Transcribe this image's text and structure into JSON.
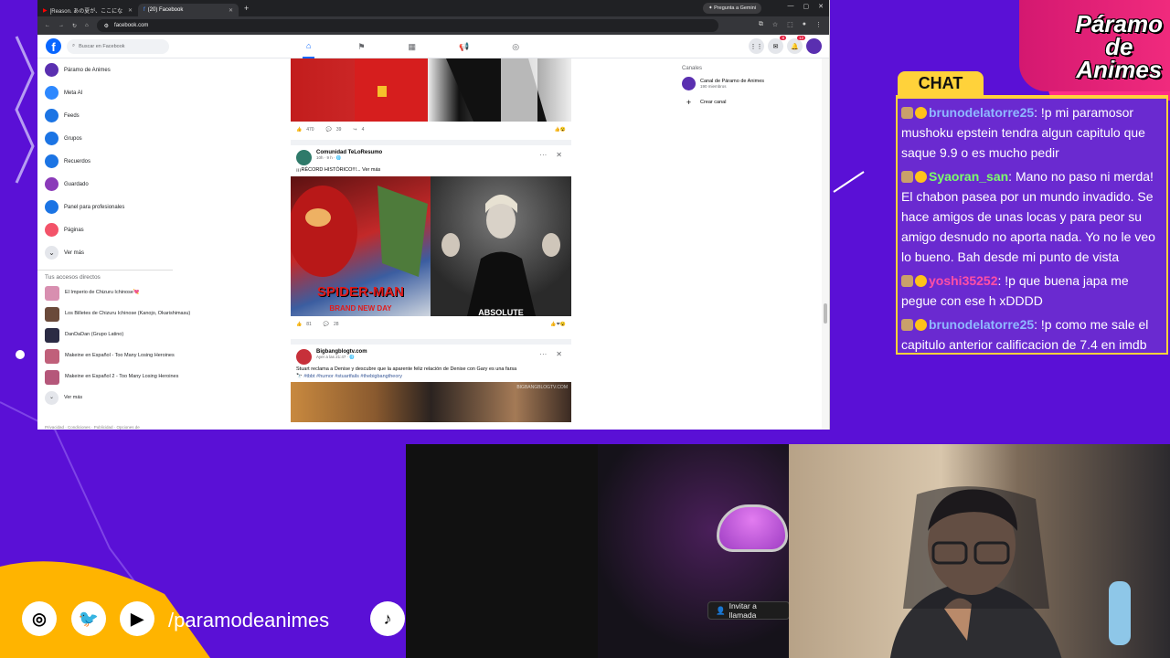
{
  "browser": {
    "tabs": [
      {
        "label": "[Reason. あの夏が、ここにな",
        "active": false
      },
      {
        "label": "(20) Facebook",
        "active": true
      }
    ],
    "gemini_label": "Pregunta a Gemini",
    "url": "facebook.com"
  },
  "fb": {
    "search_placeholder": "Buscar en Facebook",
    "badges": {
      "messenger": "8",
      "notifications": "12"
    },
    "sidebar": [
      {
        "label": "Páramo de Animes",
        "icon": "avatar",
        "color": "#5a2fb0"
      },
      {
        "label": "Meta AI",
        "icon": "meta-ai-icon",
        "color": "#2d88ff"
      },
      {
        "label": "Feeds",
        "icon": "feeds-icon",
        "color": "#1b74e4"
      },
      {
        "label": "Grupos",
        "icon": "groups-icon",
        "color": "#1b74e4"
      },
      {
        "label": "Recuerdos",
        "icon": "memories-icon",
        "color": "#1b74e4"
      },
      {
        "label": "Guardado",
        "icon": "saved-icon",
        "color": "#8a3ab9"
      },
      {
        "label": "Panel para profesionales",
        "icon": "dashboard-icon",
        "color": "#1b74e4"
      },
      {
        "label": "Páginas",
        "icon": "pages-icon",
        "color": "#f35369"
      },
      {
        "label": "Ver más",
        "icon": "chevron-down-icon",
        "color": "#e4e6eb"
      }
    ],
    "shortcuts_title": "Tus accesos directos",
    "shortcuts": [
      {
        "label": "El Imperio de Chizuru Ichinose💘",
        "color": "#d88fb0"
      },
      {
        "label": "Los Billetes de Chizuru Ichinose (Kanojo, Okarishimasu)",
        "color": "#6a4a3a"
      },
      {
        "label": "DanDaDan (Grupo Latino)",
        "color": "#2b2b44"
      },
      {
        "label": "Makeine en Español - Too Many Losing Heroines",
        "color": "#c0607a"
      },
      {
        "label": "Makeine en Español 2 - Too Many Losing Heroines",
        "color": "#b5577a"
      }
    ],
    "shortcuts_more": "Ver más",
    "legal": "Privacidad · Condiciones · Publicidad · Opciones de",
    "right_col": {
      "title": "Canales",
      "channel_name": "Canal de Páramo de Animes",
      "channel_members": "190 miembros",
      "create": "Crear canal"
    }
  },
  "posts": [
    {
      "likes": "470",
      "comments": "39",
      "shares": "4"
    },
    {
      "author": "Comunidad TeLoResumo",
      "meta": "10h · 9 h · 🌐",
      "text": "¡¡¡RÉCORD HISTÓRICO!!!... Ver más",
      "image_left_caption": "SPIDER-MAN",
      "image_left_sub": "BRAND NEW DAY",
      "image_right_caption": "ABSOLUTE",
      "likes": "81",
      "comments": "28"
    },
    {
      "author": "Bigbangblogtv.com",
      "meta": "Ayer a las 21:47 · 🌐",
      "text": "Stuart reclama a Denise y descubre que la aparente feliz relación de Denise con Gary es una farsa",
      "tags": "🔭 #tbbt #humor #stuartfails #thebigbangtheory",
      "watermark": "BIGBANGBLOGTV.COM"
    }
  ],
  "overlay": {
    "logo": [
      "Páramo",
      "de",
      "Animes"
    ],
    "chat_label": "CHAT",
    "messages": [
      {
        "user": "brunodelatorre25",
        "user_color": "#8fb8ff",
        "text": ": !p mi paramosor mushoku epstein tendra algun capitulo que saque 9.9 o es mucho pedir"
      },
      {
        "user": "Syaoran_san",
        "user_color": "#7dff6a",
        "text": ": Mano no paso ni merda! El chabon pasea por un mundo invadido. Se hace amigos de unas locas y para peor su amigo desnudo no aporta nada. Yo no le veo lo bueno. Bah desde mi punto de vista"
      },
      {
        "user": "yoshi35252",
        "user_color": "#ff4fa5",
        "text": ": !p que buena japa me pegue con ese h xDDDD"
      },
      {
        "user": "brunodelatorre25",
        "user_color": "#8fb8ff",
        "text": ": !p como me sale el capitulo anterior calificacion de 7.4 en imdb"
      }
    ],
    "invite_call": "Invitar a llamada",
    "social_handle": "/paramodeanimes",
    "social_icons": [
      "instagram-icon",
      "twitter-icon",
      "youtube-icon",
      "tiktok-icon"
    ]
  }
}
